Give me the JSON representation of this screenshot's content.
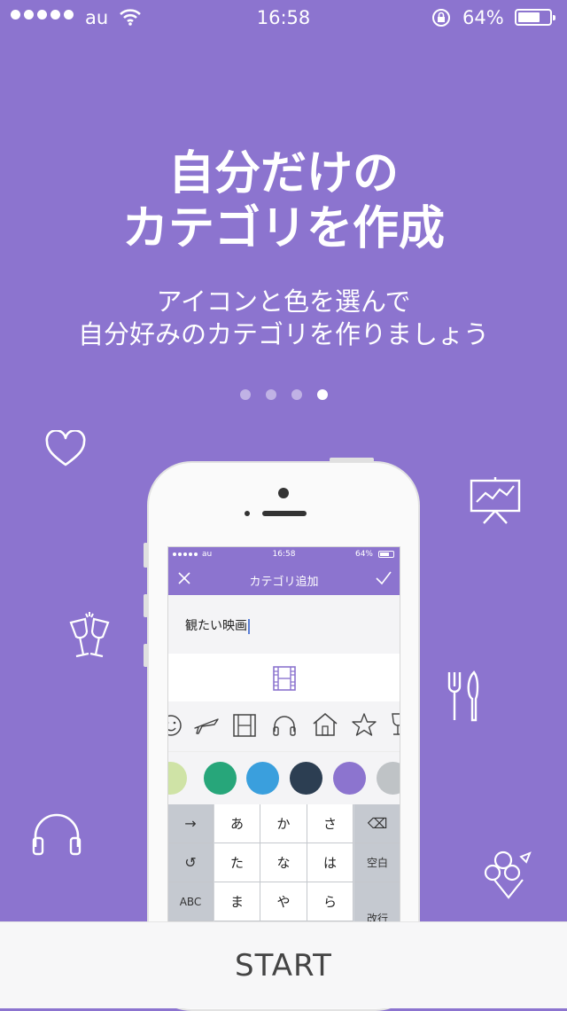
{
  "status_bar": {
    "carrier": "au",
    "time": "16:58",
    "battery": "64%"
  },
  "title_line1": "自分だけの",
  "title_line2": "カテゴリを作成",
  "subtitle_line1": "アイコンと色を選んで",
  "subtitle_line2": "自分好みのカテゴリを作りましょう",
  "pager": {
    "pages": 4,
    "current": 4
  },
  "decorative_icons": [
    "heart-icon",
    "presentation-chart-icon",
    "toast-glasses-icon",
    "fork-knife-icon",
    "headphones-icon",
    "flower-bouquet-icon"
  ],
  "phone_screen": {
    "status": {
      "carrier": "au",
      "time": "16:58",
      "battery": "64%"
    },
    "nav_title": "カテゴリ追加",
    "input_value": "観たい映画",
    "preview_icon": "film-icon",
    "icon_row": [
      "smile-icon",
      "airplane-icon",
      "film-icon",
      "headphones-icon",
      "house-icon",
      "star-icon",
      "wine-glass-icon"
    ],
    "colors": [
      "#cfe3a6",
      "#27a67a",
      "#3a9fdd",
      "#2c3e52",
      "#8c74cf",
      "#bfc3c6"
    ],
    "keyboard": {
      "left": [
        "→",
        "↺",
        "ABC"
      ],
      "row1": [
        "あ",
        "か",
        "さ"
      ],
      "row2": [
        "た",
        "な",
        "は"
      ],
      "row3": [
        "ま",
        "や",
        "ら"
      ],
      "right": [
        "⌫",
        "空白",
        "改行"
      ]
    }
  },
  "start_label": "START",
  "colors": {
    "background": "#8c74cf",
    "accent": "#8c74cf"
  }
}
